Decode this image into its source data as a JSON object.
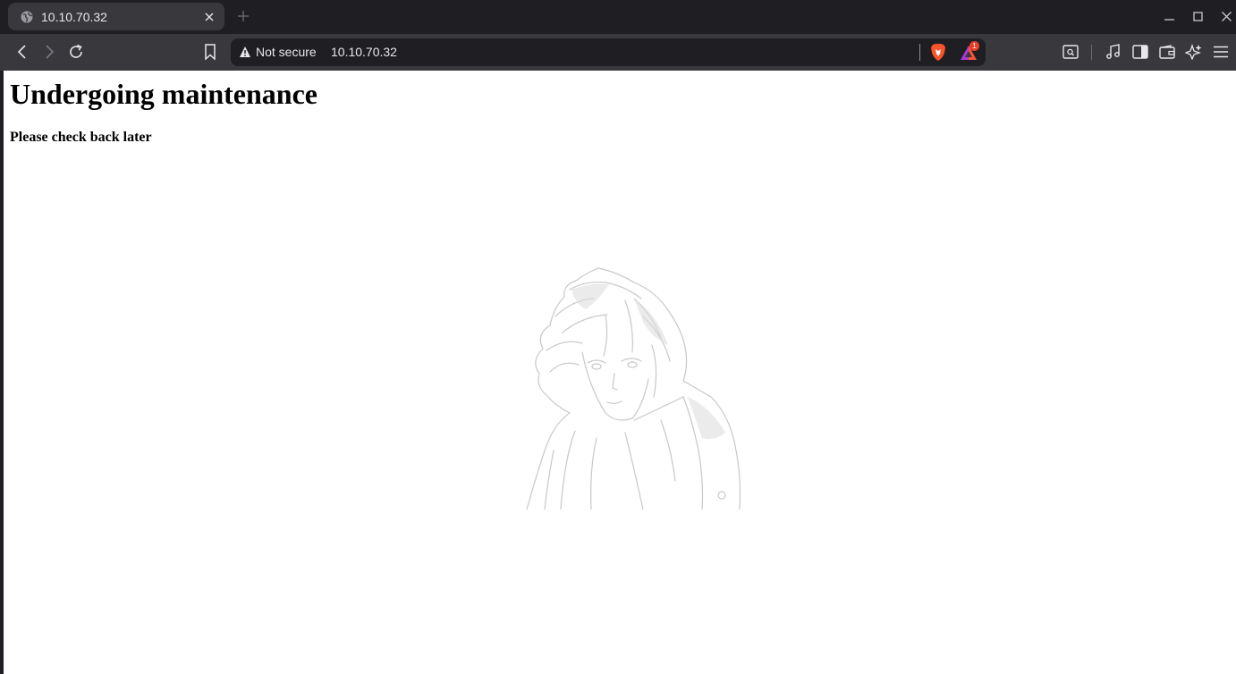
{
  "tab": {
    "title": "10.10.70.32",
    "favicon": "globe-icon"
  },
  "address_bar": {
    "security_label": "Not secure",
    "url": "10.10.70.32"
  },
  "rewards_badge": "1",
  "colors": {
    "tab_bg": "#38383d",
    "chrome_bg": "#1f1f23",
    "brave_orange": "#fb542b",
    "badge_red": "#e8402a"
  },
  "page": {
    "heading": "Undergoing maintenance",
    "subheading": "Please check back later",
    "image": "anime-character-sketch"
  }
}
